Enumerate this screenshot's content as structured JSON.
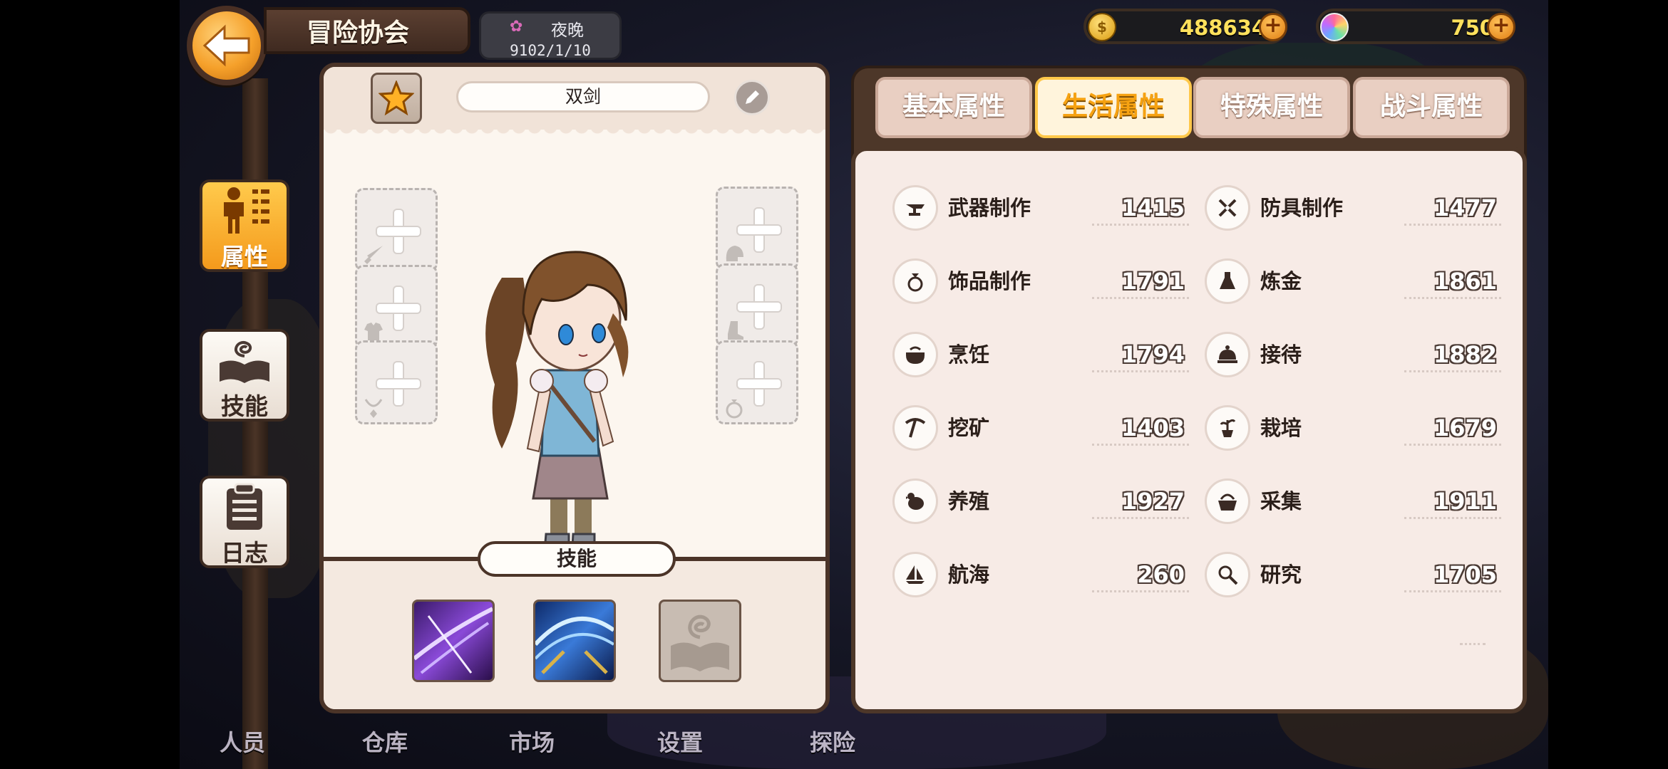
{
  "header": {
    "title": "冒险协会",
    "period": "夜晚",
    "date": "9102/1/10"
  },
  "currency": {
    "gold": "488634",
    "gems": "750"
  },
  "side_tabs": [
    {
      "label": "属性",
      "active": true
    },
    {
      "label": "技能",
      "active": false
    },
    {
      "label": "日志",
      "active": false
    }
  ],
  "character": {
    "name": "双剑",
    "skills_heading": "技能"
  },
  "attr_tabs": [
    {
      "label": "基本属性",
      "active": false
    },
    {
      "label": "生活属性",
      "active": true
    },
    {
      "label": "特殊属性",
      "active": false
    },
    {
      "label": "战斗属性",
      "active": false
    }
  ],
  "life_attributes": [
    {
      "icon": "anvil-icon",
      "label": "武器制作",
      "value": "1415"
    },
    {
      "icon": "crossed-tools-icon",
      "label": "防具制作",
      "value": "1477"
    },
    {
      "icon": "ring-icon",
      "label": "饰品制作",
      "value": "1791"
    },
    {
      "icon": "flask-icon",
      "label": "炼金",
      "value": "1861"
    },
    {
      "icon": "cooking-pot-icon",
      "label": "烹饪",
      "value": "1794"
    },
    {
      "icon": "service-bell-icon",
      "label": "接待",
      "value": "1882"
    },
    {
      "icon": "pickaxe-icon",
      "label": "挖矿",
      "value": "1403"
    },
    {
      "icon": "potted-plant-icon",
      "label": "栽培",
      "value": "1679"
    },
    {
      "icon": "chicken-icon",
      "label": "养殖",
      "value": "1927"
    },
    {
      "icon": "gathering-basket-icon",
      "label": "采集",
      "value": "1911"
    },
    {
      "icon": "sailboat-icon",
      "label": "航海",
      "value": "260"
    },
    {
      "icon": "magnifier-icon",
      "label": "研究",
      "value": "1705"
    }
  ],
  "bottom_nav": [
    "人员",
    "仓库",
    "市场",
    "设置",
    "探险"
  ],
  "colors": {
    "accent": "#f6a212",
    "panel_border": "#4b3428",
    "panel_bg": "#fcf6ef",
    "gold_text": "#ffe15c"
  }
}
